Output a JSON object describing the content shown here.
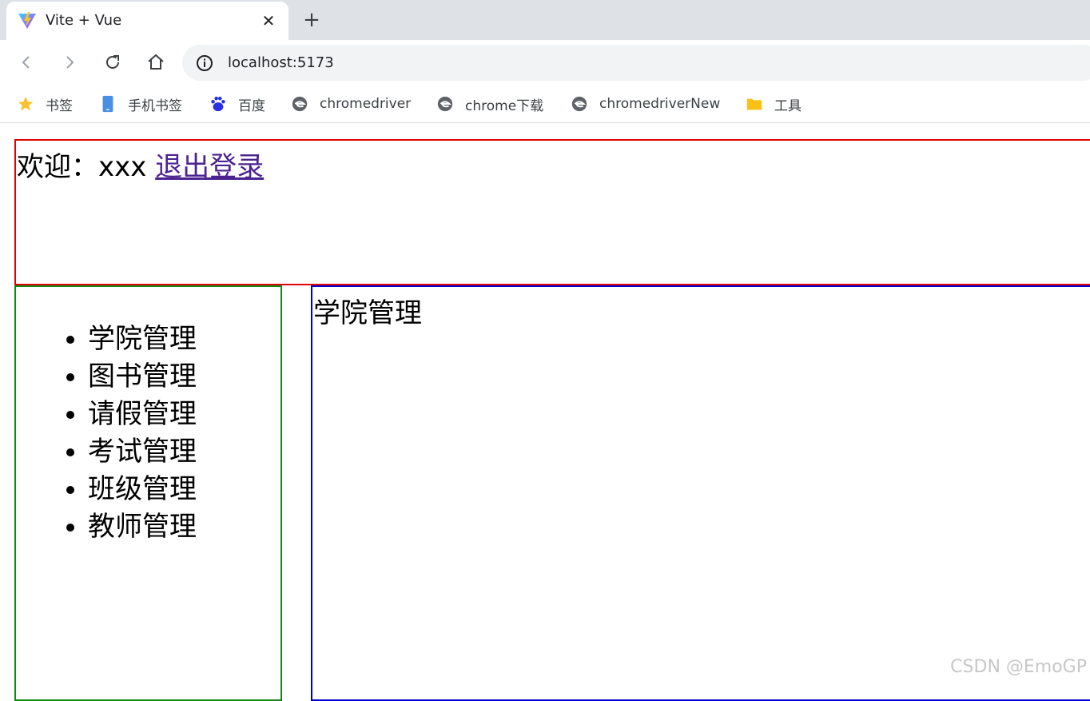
{
  "browser": {
    "tab": {
      "title": "Vite + Vue",
      "favicon": "vite-logo-icon",
      "close": "✕"
    },
    "new_tab": "+",
    "url": "localhost:5173",
    "bookmarks": [
      {
        "label": "书签",
        "icon": "star-icon"
      },
      {
        "label": "手机书签",
        "icon": "phone-icon"
      },
      {
        "label": "百度",
        "icon": "baidu-paw-icon"
      },
      {
        "label": "chromedriver",
        "icon": "edge-logo-icon"
      },
      {
        "label": "chrome下载",
        "icon": "edge-logo-icon"
      },
      {
        "label": "chromedriverNew",
        "icon": "edge-logo-icon"
      },
      {
        "label": "工具",
        "icon": "folder-icon"
      }
    ]
  },
  "header": {
    "welcome": "欢迎：xxx ",
    "logout": "退出登录"
  },
  "sidebar": {
    "items": [
      "学院管理",
      "图书管理",
      "请假管理",
      "考试管理",
      "班级管理",
      "教师管理"
    ]
  },
  "main": {
    "title": "学院管理"
  },
  "watermark": "CSDN @EmoGP",
  "colors": {
    "header_border": "#e00000",
    "sidebar_border": "#108a10",
    "main_border": "#0000cc",
    "visited_link": "#4b2391"
  }
}
